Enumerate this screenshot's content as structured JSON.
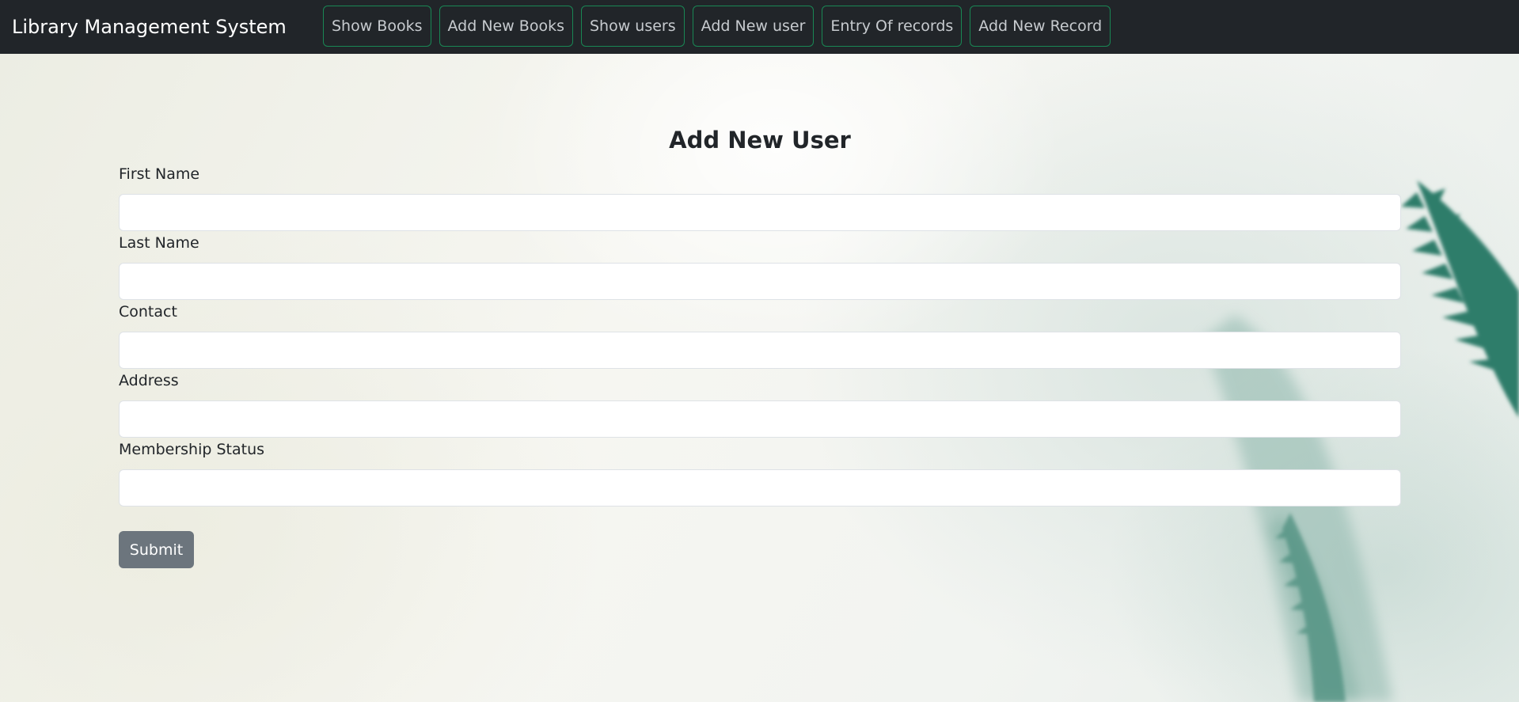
{
  "app": {
    "title": "Library Management System"
  },
  "nav": {
    "items": [
      {
        "label": "Show Books"
      },
      {
        "label": "Add New Books"
      },
      {
        "label": "Show users"
      },
      {
        "label": "Add New user"
      },
      {
        "label": "Entry Of records"
      },
      {
        "label": "Add New Record"
      }
    ]
  },
  "form": {
    "title": "Add New User",
    "fields": [
      {
        "label": "First Name",
        "value": ""
      },
      {
        "label": "Last Name",
        "value": ""
      },
      {
        "label": "Contact",
        "value": ""
      },
      {
        "label": "Address",
        "value": ""
      },
      {
        "label": "Membership Status",
        "value": ""
      }
    ],
    "submit_label": "Submit"
  },
  "colors": {
    "navbar_bg": "#212529",
    "nav_border": "#198754",
    "submit_bg": "#6c757d",
    "fern_green": "#2f7d6a"
  }
}
